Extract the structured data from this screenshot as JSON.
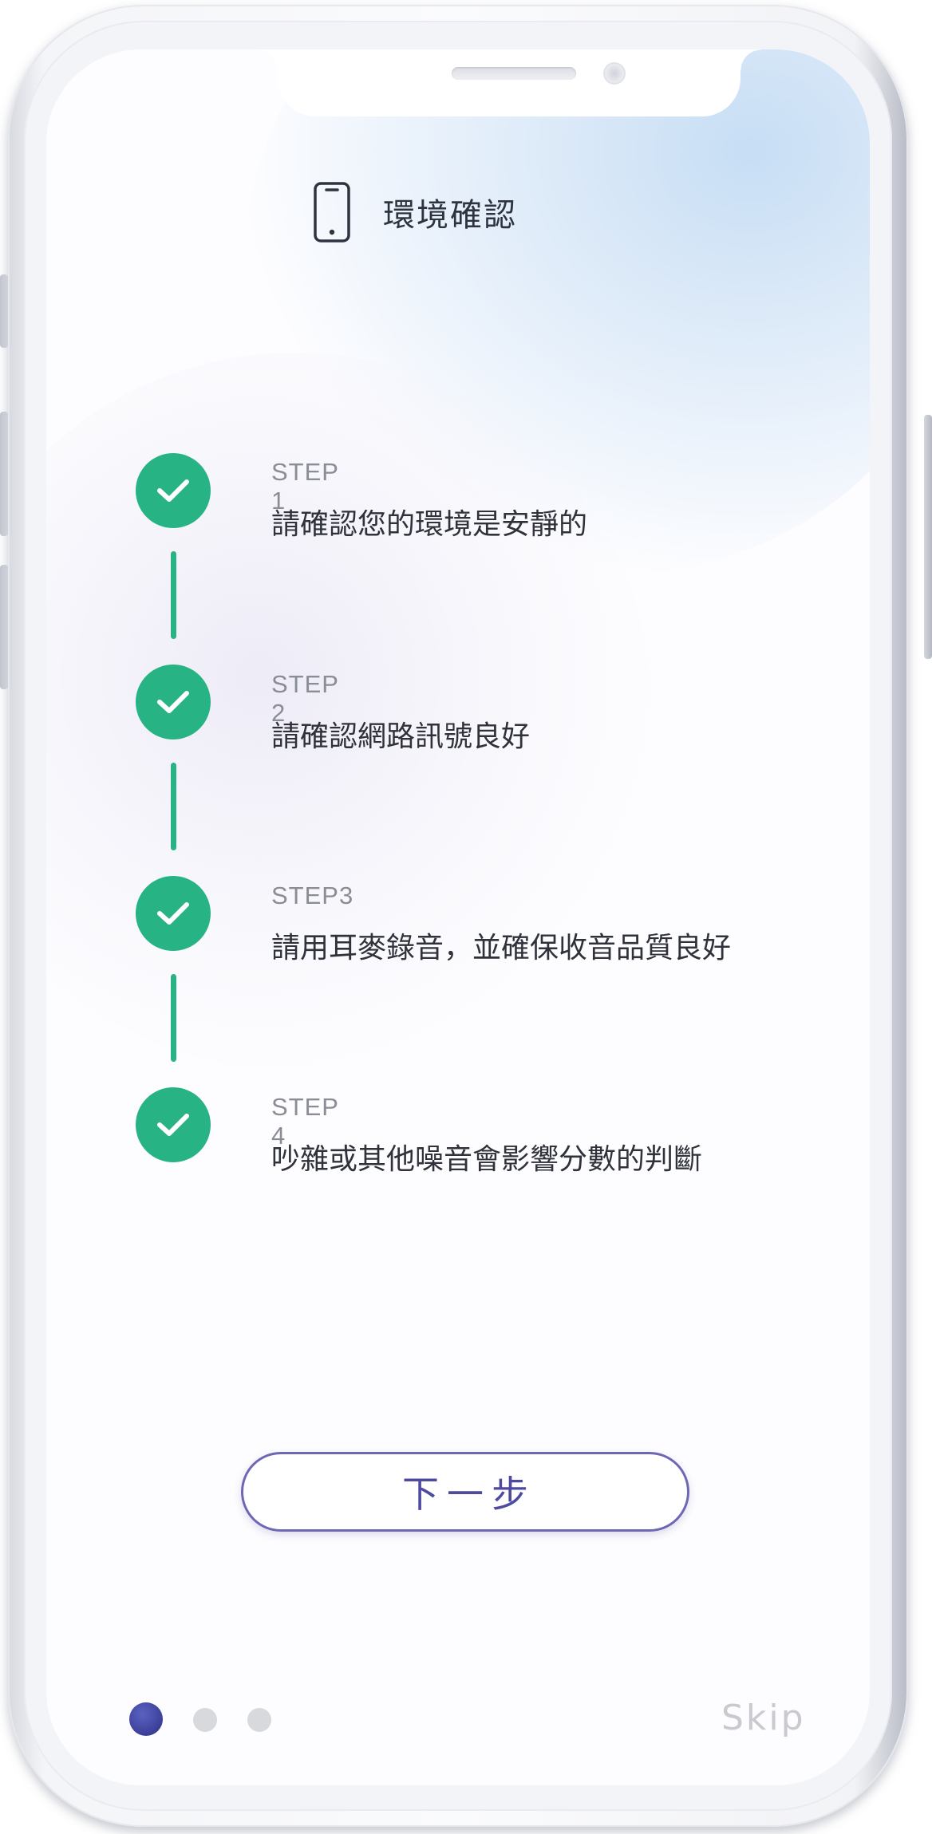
{
  "header": {
    "icon": "smartphone-icon",
    "title": "環境確認"
  },
  "steps": [
    {
      "label": "STEP 1",
      "description": "請確認您的環境是安靜的",
      "status": "completed",
      "icon": "check-icon"
    },
    {
      "label": "STEP 2",
      "description": "請確認網路訊號良好",
      "status": "completed",
      "icon": "check-icon"
    },
    {
      "label": "STEP3",
      "description": "請用耳麥錄音，並確保收音品質良好",
      "status": "completed",
      "icon": "check-icon"
    },
    {
      "label": "STEP 4",
      "description": "吵雜或其他噪音會影響分數的判斷",
      "status": "completed",
      "icon": "check-icon"
    }
  ],
  "next_button": {
    "label": "下一步"
  },
  "pagination": {
    "current": 1,
    "total": 3
  },
  "skip": {
    "label": "Skip"
  },
  "colors": {
    "step_complete": "#27b383",
    "accent": "#4d4aa0",
    "dot_active": "#3b3f98",
    "dot_inactive": "#d8d9dd",
    "skip_text": "#c9cacf"
  }
}
